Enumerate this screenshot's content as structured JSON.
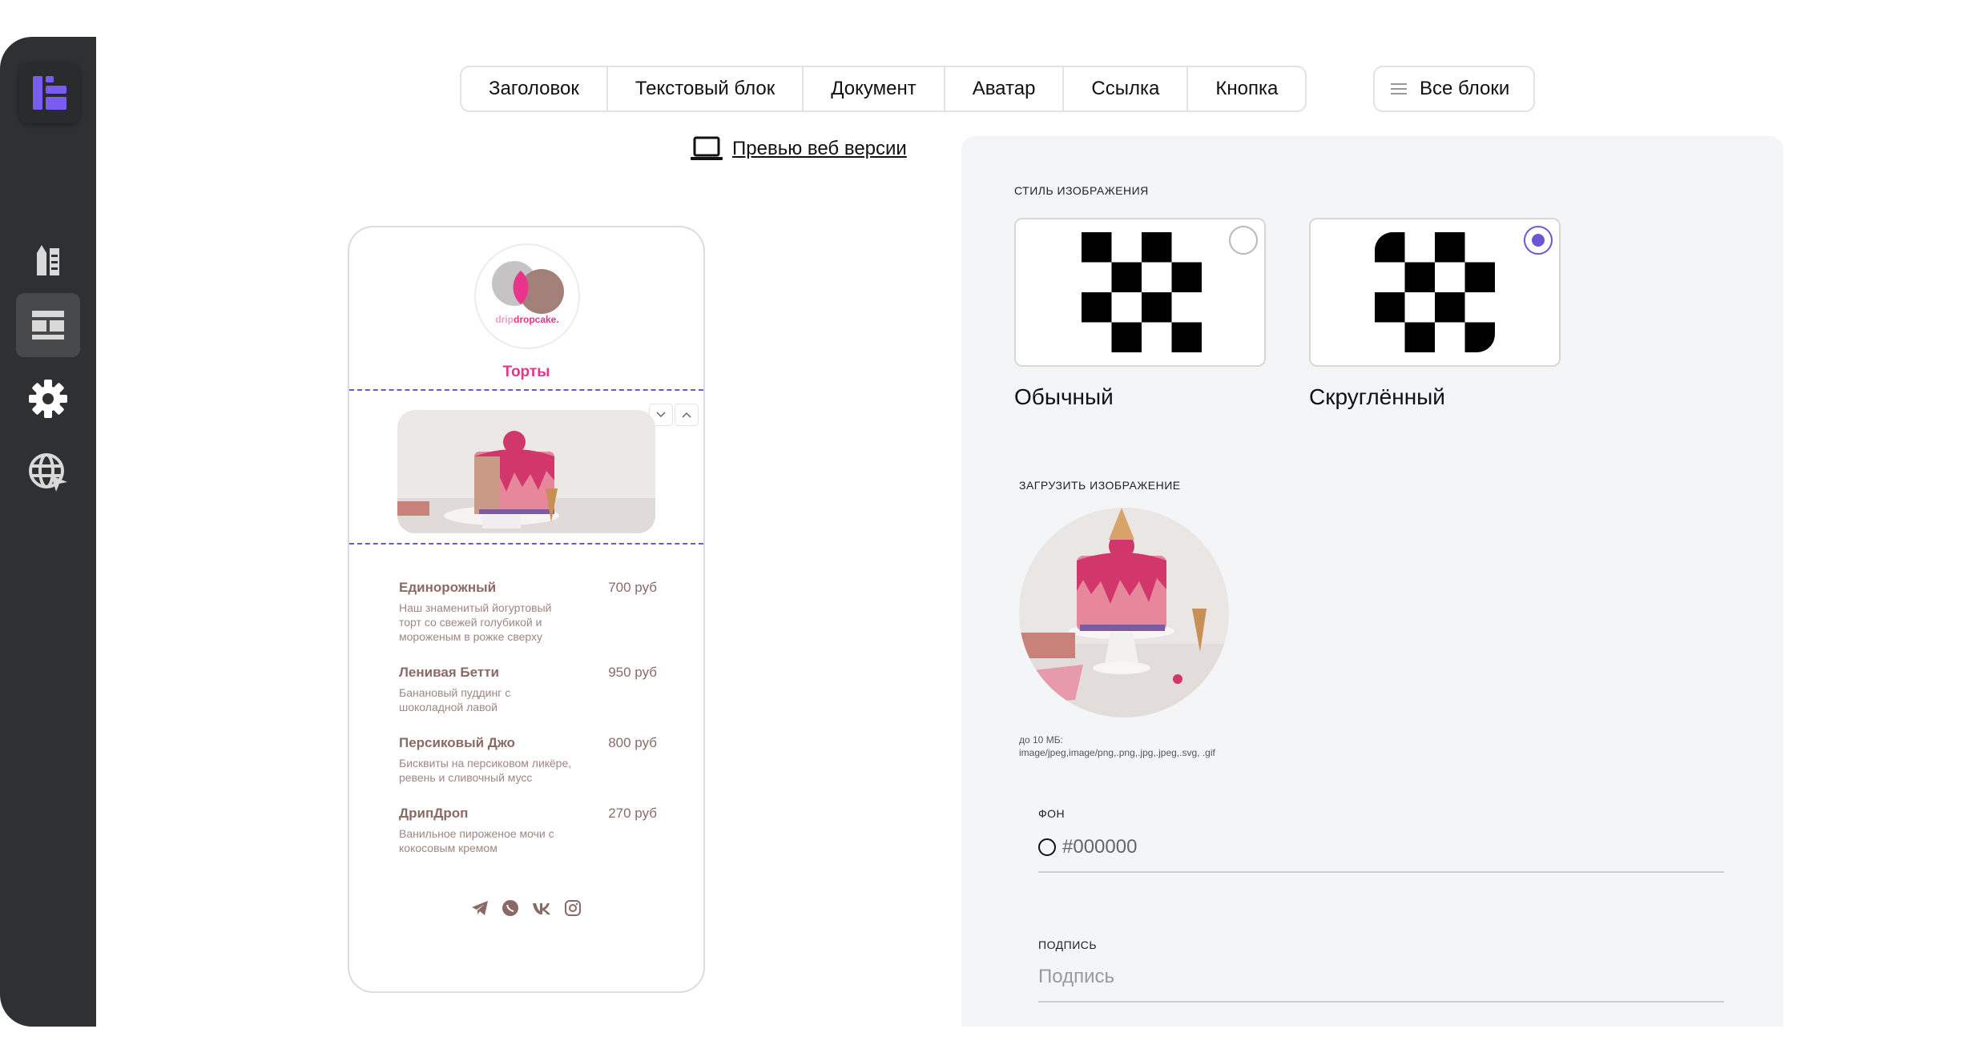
{
  "toolbar": {
    "tabs": [
      "Заголовок",
      "Текстовый блок",
      "Документ",
      "Аватар",
      "Ссылка",
      "Кнопка"
    ],
    "all_blocks": "Все блоки"
  },
  "preview": {
    "label": "Превью веб версии"
  },
  "phone": {
    "logo_text_a": "drip",
    "logo_text_b": "dropcake.",
    "category": "Торты",
    "items": [
      {
        "name": "Единорожный",
        "price": "700 руб",
        "desc": "Наш знаменитый йогуртовый торт со свежей голубикой и мороженым в рожке сверху"
      },
      {
        "name": "Ленивая Бетти",
        "price": "950 руб",
        "desc": "Банановый пуддинг с шоколадной лавой"
      },
      {
        "name": "Персиковый Джо",
        "price": "800 руб",
        "desc": "Бисквиты на персиковом ликёре, ревень и сливочный мусс"
      },
      {
        "name": "ДрипДроп",
        "price": "270 руб",
        "desc": "Ванильное пироженое мочи с кокосовым кремом"
      }
    ],
    "socials": [
      "telegram-icon",
      "whatsapp-icon",
      "vk-icon",
      "instagram-icon"
    ]
  },
  "panel": {
    "image_style_label": "СТИЛЬ ИЗОБРАЖЕНИЯ",
    "style_normal": "Обычный",
    "style_rounded": "Скруглённый",
    "selected_style": "rounded",
    "upload_label": "ЗАГРУЗИТЬ ИЗОБРАЖЕНИЕ",
    "upload_hint_1": "до 10 МБ:",
    "upload_hint_2": "image/jpeg,image/png,.png,.jpg,.jpeg,.svg, .gif",
    "bg_label": "ФОН",
    "bg_value": "#000000",
    "caption_label": "ПОДПИСЬ",
    "caption_placeholder": "Подпись"
  },
  "colors": {
    "accent": "#6b57d6",
    "brand_pink": "#e8348b",
    "sidebar": "#2f3031"
  }
}
